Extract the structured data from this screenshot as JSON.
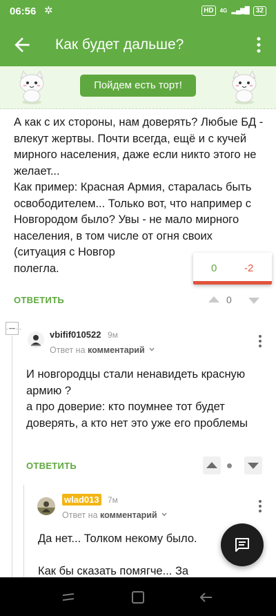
{
  "status_bar": {
    "time": "06:56",
    "hd_label": "HD",
    "network": "4G",
    "battery": "32"
  },
  "app_bar": {
    "title": "Как будет дальше?",
    "back_icon": "arrow-left-icon",
    "menu_icon": "more-vertical-icon"
  },
  "banner": {
    "button_label": "Пойдем есть торт!"
  },
  "main_comment": {
    "text_para1": "А как с их стороны, нам доверять? Любые БД - влекут жертвы. Почти всегда, ещё и с кучей мирного населения, даже если никто этого не желает...",
    "text_para2": "Как пример: Красная Армия, старалась быть освободителем... Только вот, что например с Новгородом было? Увы - не мало мирного населения, в том числе от огня своих (ситуация с Новгор",
    "text_para3": "полегла.",
    "reply_label": "ОТВЕТИТЬ",
    "score": "0",
    "rating_plus": "0",
    "rating_minus": "-2"
  },
  "reply_1": {
    "username": "vbifif010522",
    "time": "9м",
    "reply_prefix": "Ответ на",
    "reply_target": "комментарий",
    "text_para1": "И новгородцы стали ненавидеть красную армию ?",
    "text_para2": "а про доверие: кто поумнее тот будет доверять, а кто нет это уже его проблемы",
    "reply_label": "ОТВЕТИТЬ"
  },
  "reply_2": {
    "username": "wlad013",
    "time": "7м",
    "reply_prefix": "Ответ на",
    "reply_target": "комментарий",
    "text_para1": "Да нет... Толком некому было.",
    "text_para2": "Как бы сказать помягче... За"
  },
  "colors": {
    "brand_green": "#62ad44",
    "banner_bg": "#eef8e6",
    "negative_red": "#e0533b",
    "highlight_name": "#f3b514"
  }
}
